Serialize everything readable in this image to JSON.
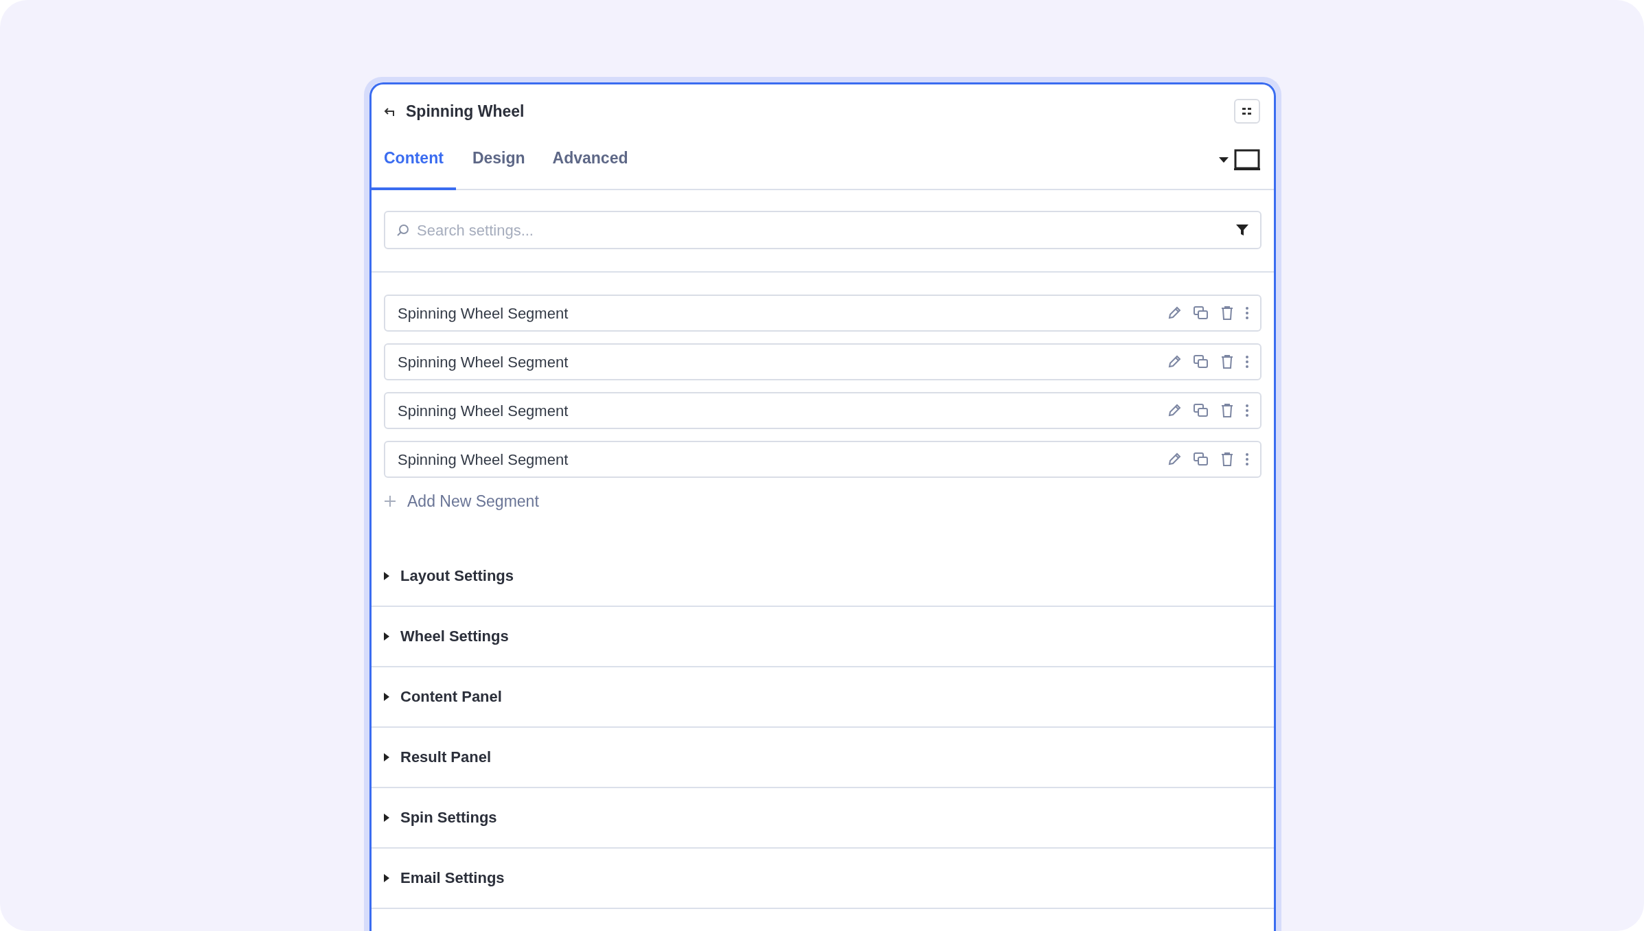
{
  "header": {
    "title": "Spinning Wheel"
  },
  "tabs": [
    {
      "label": "Content",
      "selected": true
    },
    {
      "label": "Design",
      "selected": false
    },
    {
      "label": "Advanced",
      "selected": false
    }
  ],
  "search": {
    "placeholder": "Search settings..."
  },
  "segments": [
    {
      "label": "Spinning Wheel Segment"
    },
    {
      "label": "Spinning Wheel Segment"
    },
    {
      "label": "Spinning Wheel Segment"
    },
    {
      "label": "Spinning Wheel Segment"
    }
  ],
  "add_button": {
    "label": "Add New Segment"
  },
  "sections": [
    {
      "label": "Layout Settings",
      "expanded": false
    },
    {
      "label": "Wheel Settings",
      "expanded": false
    },
    {
      "label": "Content Panel",
      "expanded": false
    },
    {
      "label": "Result Panel",
      "expanded": false
    },
    {
      "label": "Spin Settings",
      "expanded": false
    },
    {
      "label": "Email Settings",
      "expanded": false
    }
  ]
}
